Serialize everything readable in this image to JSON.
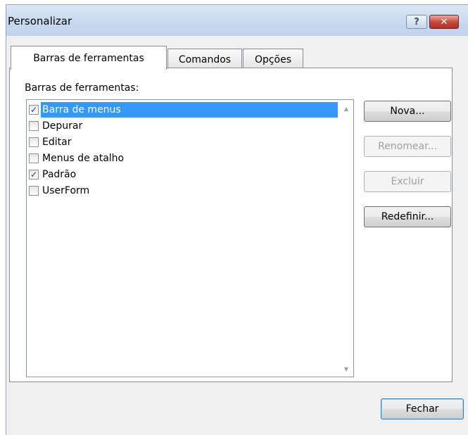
{
  "window": {
    "title": "Personalizar",
    "help_glyph": "?",
    "close_glyph": "✕"
  },
  "tabs": [
    {
      "label": "Barras de ferramentas",
      "active": true
    },
    {
      "label": "Comandos",
      "active": false
    },
    {
      "label": "Opções",
      "active": false
    }
  ],
  "toolbars": {
    "label": "Barras de ferramentas:",
    "items": [
      {
        "label": "Barra de menus",
        "checked": true,
        "selected": true
      },
      {
        "label": "Depurar",
        "checked": false,
        "selected": false
      },
      {
        "label": "Editar",
        "checked": false,
        "selected": false
      },
      {
        "label": "Menus de atalho",
        "checked": false,
        "selected": false
      },
      {
        "label": "Padrão",
        "checked": true,
        "selected": false
      },
      {
        "label": "UserForm",
        "checked": false,
        "selected": false
      }
    ],
    "scroll_up": "▲",
    "scroll_down": "▼"
  },
  "buttons": {
    "new": "Nova...",
    "rename": "Renomear...",
    "delete": "Excluir",
    "reset": "Redefinir...",
    "close": "Fechar"
  },
  "check_glyph": "✓"
}
